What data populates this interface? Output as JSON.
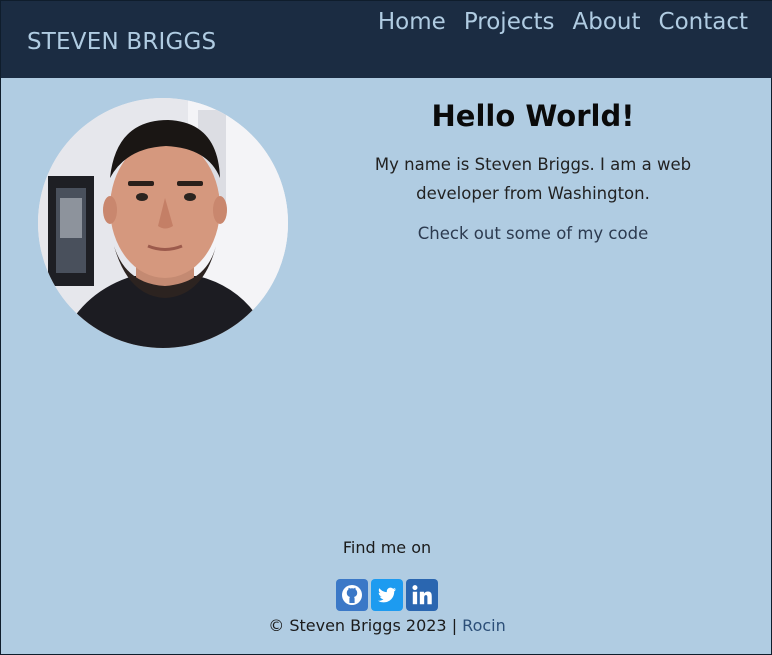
{
  "header": {
    "brand": "STEVEN BRIGGS",
    "nav": [
      "Home",
      "Projects",
      "About",
      "Contact"
    ]
  },
  "intro": {
    "heading": "Hello World!",
    "bio": "My name is Steven Briggs. I am a web developer from Washington.",
    "code_link": "Check out some of my code"
  },
  "footer": {
    "find_me": "Find me on",
    "socials": [
      {
        "icon": "github-icon",
        "color": "#3b78c7"
      },
      {
        "icon": "twitter-icon",
        "color": "#1d9bf0"
      },
      {
        "icon": "linkedin-icon",
        "color": "#2a66b0"
      }
    ],
    "copyright": "© Steven Briggs 2023 |",
    "credit": "Rocin"
  },
  "colors": {
    "header_bg": "#1b2c42",
    "page_bg": "#b0cce2",
    "accent": "#2c4f78"
  }
}
